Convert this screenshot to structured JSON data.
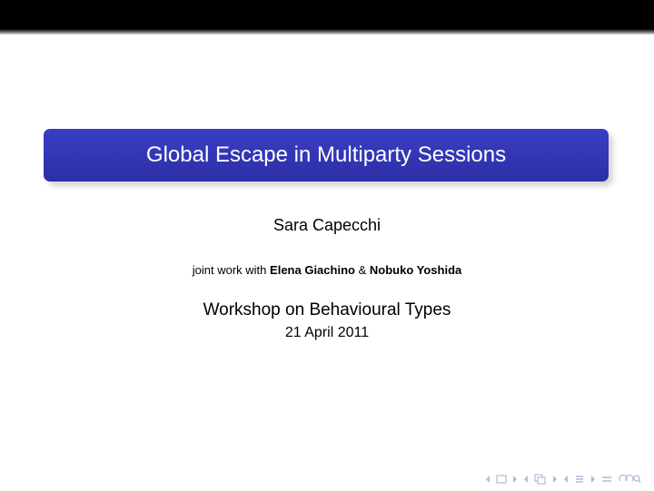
{
  "slide": {
    "title": "Global Escape in Multiparty Sessions",
    "author": "Sara Capecchi",
    "joint_prefix": "joint work with",
    "coauthor_1": "Elena Giachino",
    "amp": "&",
    "coauthor_2": "Nobuko Yoshida",
    "venue": "Workshop on Behavioural Types",
    "date": "21 April 2011"
  },
  "colors": {
    "title_box": "#2f33b0",
    "title_text": "#ffffff",
    "nav_icons": "#b8b8d8",
    "top_bar": "#000000"
  },
  "navigation": {
    "icons": [
      "frame-prev-icon",
      "frame-icon",
      "frame-next-icon",
      "subsection-prev-icon",
      "subsection-icon",
      "subsection-next-icon",
      "section-prev-icon",
      "section-icon",
      "section-next-icon",
      "align-icon",
      "search-icon"
    ]
  }
}
